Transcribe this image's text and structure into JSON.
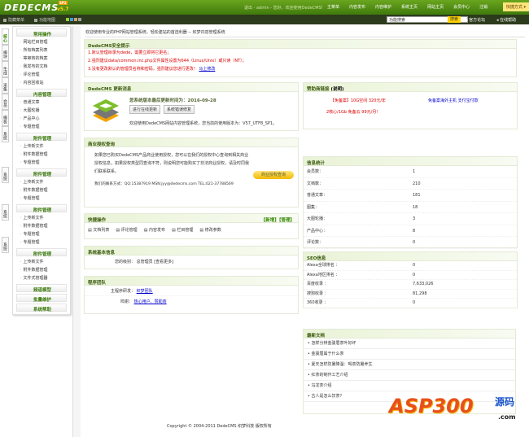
{
  "header": {
    "logo": "DEDECMS",
    "version": "v5.7",
    "badge": "SP2",
    "welcome": "退出 - admin - 您好，欢迎使用DedeCMS!",
    "nav": [
      "主菜单",
      "内容发布",
      "内容维护",
      "系统主页",
      "网站主页",
      "会员中心",
      "注销"
    ],
    "quick": "快捷方式 ▾"
  },
  "toolbar": {
    "hide_menu": "隐藏菜单",
    "func_map": "功能地图",
    "search_value": "功能搜索",
    "search_btn": "搜索",
    "forum": "官方论坛",
    "help": "在线帮助",
    "swatches": [
      "#9bcc3c",
      "#3aa0e0",
      "#c9a36e",
      "#a0a0a0"
    ]
  },
  "tabs": [
    "核心",
    "模块",
    "生成",
    "采集",
    "会员",
    "模板",
    "系统",
    "系统",
    "系统",
    "系统"
  ],
  "menu": [
    {
      "title": "常用操作",
      "items": [
        "网站栏目管理",
        "所有档案列表",
        "等审核的档案",
        "我发布的文档",
        "评论管理",
        "内容回收站"
      ]
    },
    {
      "title": "内容管理",
      "items": [
        "普通文章",
        "大图轮播",
        "产品中心",
        "专题管理"
      ]
    },
    {
      "title": "附件管理",
      "items": [
        "上传新文件",
        "附件数据管理",
        "专题管理"
      ]
    },
    {
      "title": "附件管理",
      "items": [
        "上传新文件",
        "附件数据管理",
        "专题管理"
      ]
    },
    {
      "title": "附件管理",
      "items": [
        "上传新文件",
        "附件数据管理",
        "专题管理",
        "专题管理"
      ]
    },
    {
      "title": "附件管理",
      "items": [
        "上传新文件",
        "附件数据管理",
        "文件式管理器"
      ]
    },
    {
      "title": "频道模型",
      "items": []
    },
    {
      "title": "批量维护",
      "items": []
    },
    {
      "title": "系统帮助",
      "items": []
    }
  ],
  "main": {
    "welcome": "欢迎使用专业的PHP网站管理系统，轻松建站的首选利器 -- 织梦内容管理系统",
    "security": {
      "title": "DedeCMS安全提示",
      "lines": [
        "1.默认管理目录为dede，需要立即将它更名；",
        "2.强烈建议data/common.inc.php文件属性设置为644（Linux/Unix）或只读（NT）；",
        "3.没有更改默认的管理员名称和密码，强烈建议您进行更改！"
      ],
      "link": "马上修改"
    },
    "update": {
      "title": "DedeCMS 更新消息",
      "date_line": "您系统版本最后更新时间为：2016-09-28",
      "btn1": "进行在线更新",
      "btn2": "系统错误修复",
      "version_line": "欢迎使用DedeCMS网站内容管理系统，您当前的使用版本为：V57_UTF8_SP1。"
    },
    "license": {
      "title": "商业授权查询",
      "text": "如果您已购买DedeCMS产品商业使用授权，您可以在我们的授权中心查询到相关商业授权信息，如果授权类型同查询不符，则说明您可能购买了非法商业授权，请及时同我们联系联系。",
      "contact": "我们的联系方式：QQ:15387919 MSN:jyy@dedecms.com TEL:021-37788569",
      "button": "商业授权查询"
    },
    "quick": {
      "title": "快捷操作",
      "actions": "【新增】【管理】",
      "items": [
        "文档列表",
        "评论管理",
        "内容发布",
        "栏目管理",
        "修改参数"
      ]
    },
    "sysinfo": {
      "title": "系统基本信息",
      "label": "您的级别：",
      "value": "总管理员 [查看更多]"
    },
    "team": {
      "title": "程序团队",
      "dev_label": "主程序研发：",
      "dev": "织梦团队",
      "thanks_label": "鸣谢：",
      "thanks": "热心用户、赞助商"
    },
    "sponsor": {
      "title": "赞助商链接",
      "note": "(说明)",
      "l1": "【免备案】10G空间 320元/年",
      "l2": "免备案海外主机 支付宝付款",
      "l3": "2核心/1Gb 免备云 99元/月!"
    },
    "stats": {
      "title": "信息统计",
      "rows": [
        [
          "会员数：",
          "1"
        ],
        [
          "文档数：",
          "210"
        ],
        [
          "普通文章：",
          "181"
        ],
        [
          "图集：",
          "18"
        ],
        [
          "大图轮播：",
          "3"
        ],
        [
          "产品中心：",
          "8"
        ],
        [
          "评论数：",
          "0"
        ]
      ]
    },
    "seo": {
      "title": "SEO信息",
      "rows": [
        [
          "Alexa全球排名 ：",
          "0"
        ],
        [
          "Alexa地区排名 ：",
          "0"
        ],
        [
          "百度收录 ：",
          "7,633,026"
        ],
        [
          "搜狗收录 ：",
          "81,298"
        ],
        [
          "360收录 ：",
          "0"
        ]
      ]
    },
    "latest": {
      "title": "最新文档",
      "items": [
        "怎样分辨金骏眉茶叶好坏",
        "金骏眉属于什么茶",
        "夏天怎样防暑降温：喝茶防暑养生",
        "红茶的制作工艺介绍",
        "乌龙茶介绍",
        "古人是怎么饮茶？"
      ]
    },
    "footer": "Copyright © 2004-2011 DedeCMS 织梦科技 版权所有"
  },
  "watermark": {
    "text": "ASP300",
    "cn": "源码",
    "com": ".com"
  }
}
